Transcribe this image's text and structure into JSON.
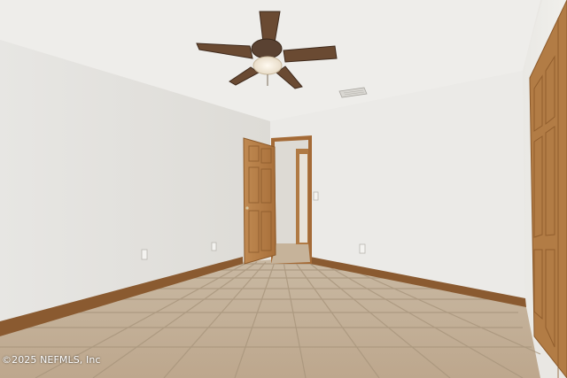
{
  "photo": {
    "watermark": "©2025 NEFMLS, Inc",
    "colors": {
      "ceiling": "#eeedea",
      "wall_left": "#e4e3e0",
      "wall_back": "#ebeae7",
      "wall_right": "#e8e7e3",
      "floor_tile": "#c9b59c",
      "grout": "#9c8a73",
      "baseboard": "#8a5a30",
      "door_wood": "#b9824a",
      "fan_blade": "#6a4a32"
    }
  }
}
